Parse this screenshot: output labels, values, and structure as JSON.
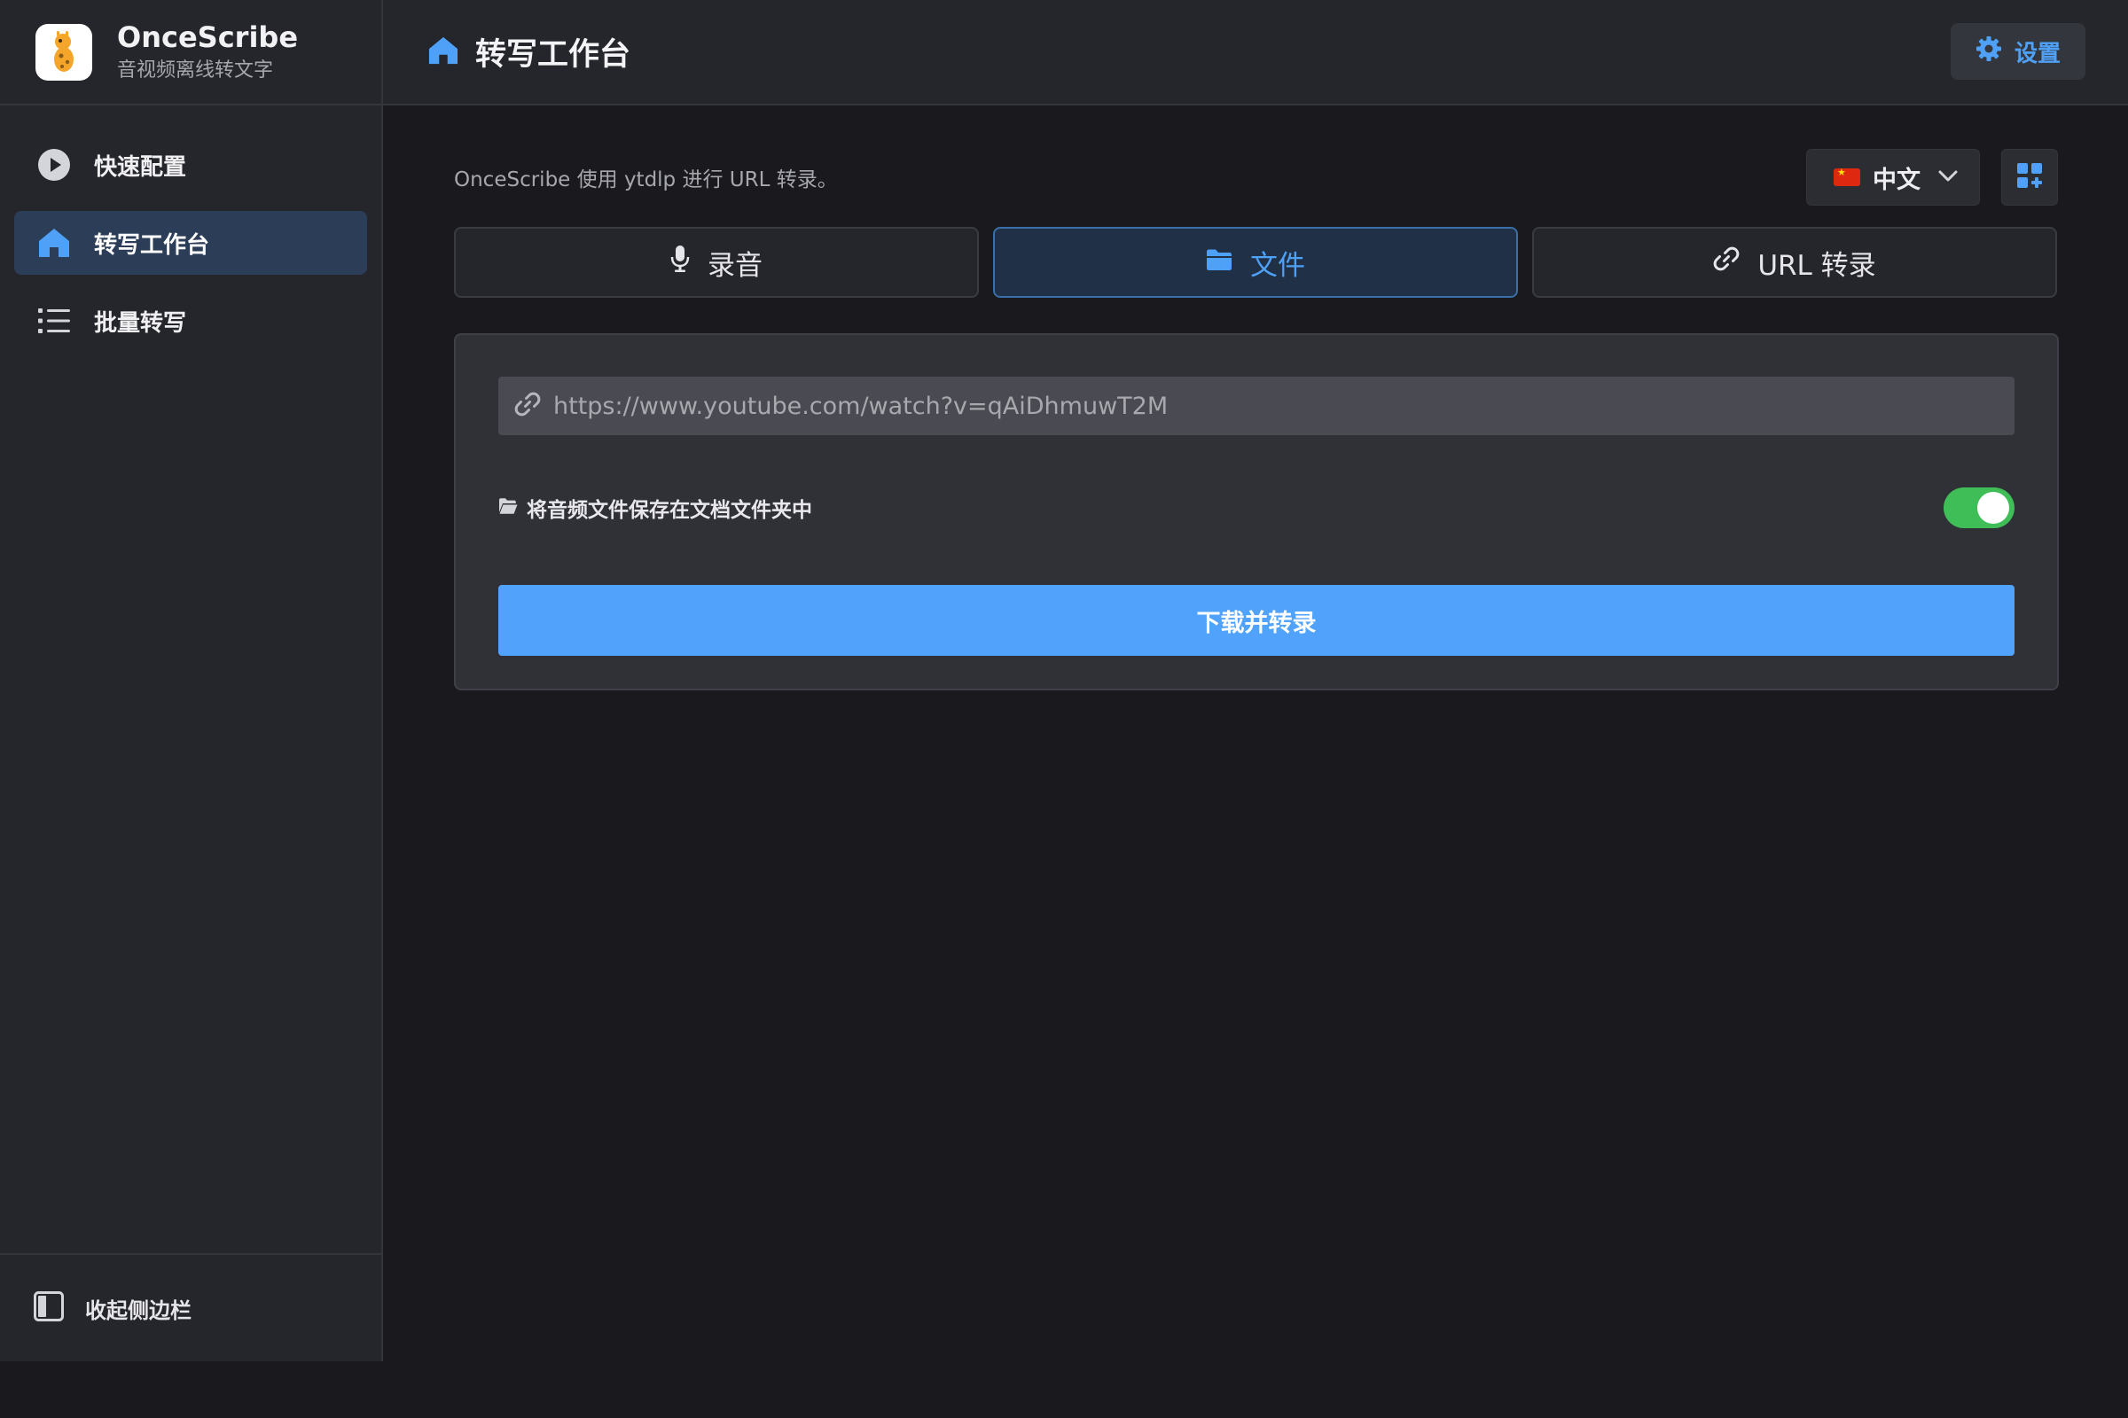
{
  "app": {
    "name": "OnceScribe",
    "subtitle": "音视频离线转文字"
  },
  "sidebar": {
    "items": [
      {
        "label": "快速配置",
        "icon": "play-circle-icon",
        "active": false
      },
      {
        "label": "转写工作台",
        "icon": "home-icon",
        "active": true
      },
      {
        "label": "批量转写",
        "icon": "list-icon",
        "active": false
      }
    ],
    "collapse_label": "收起侧边栏"
  },
  "header": {
    "title": "转写工作台",
    "settings_label": "设置"
  },
  "main": {
    "info": "OnceScribe 使用 ytdlp 进行 URL 转录。",
    "language": "中文",
    "tabs": [
      {
        "label": "录音",
        "icon": "microphone-icon",
        "active": false
      },
      {
        "label": "文件",
        "icon": "folder-icon",
        "active": true
      },
      {
        "label": "URL 转录",
        "icon": "link-icon",
        "active": false
      }
    ],
    "url_placeholder": "https://www.youtube.com/watch?v=qAiDhmuwT2M",
    "save_audio_label": "将音频文件保存在文档文件夹中",
    "save_audio_enabled": true,
    "submit_label": "下载并转录"
  },
  "colors": {
    "accent": "#50a2fa",
    "toggle_on": "#3fbe58",
    "sidebar_bg": "#25262b",
    "content_bg": "#19191e"
  }
}
